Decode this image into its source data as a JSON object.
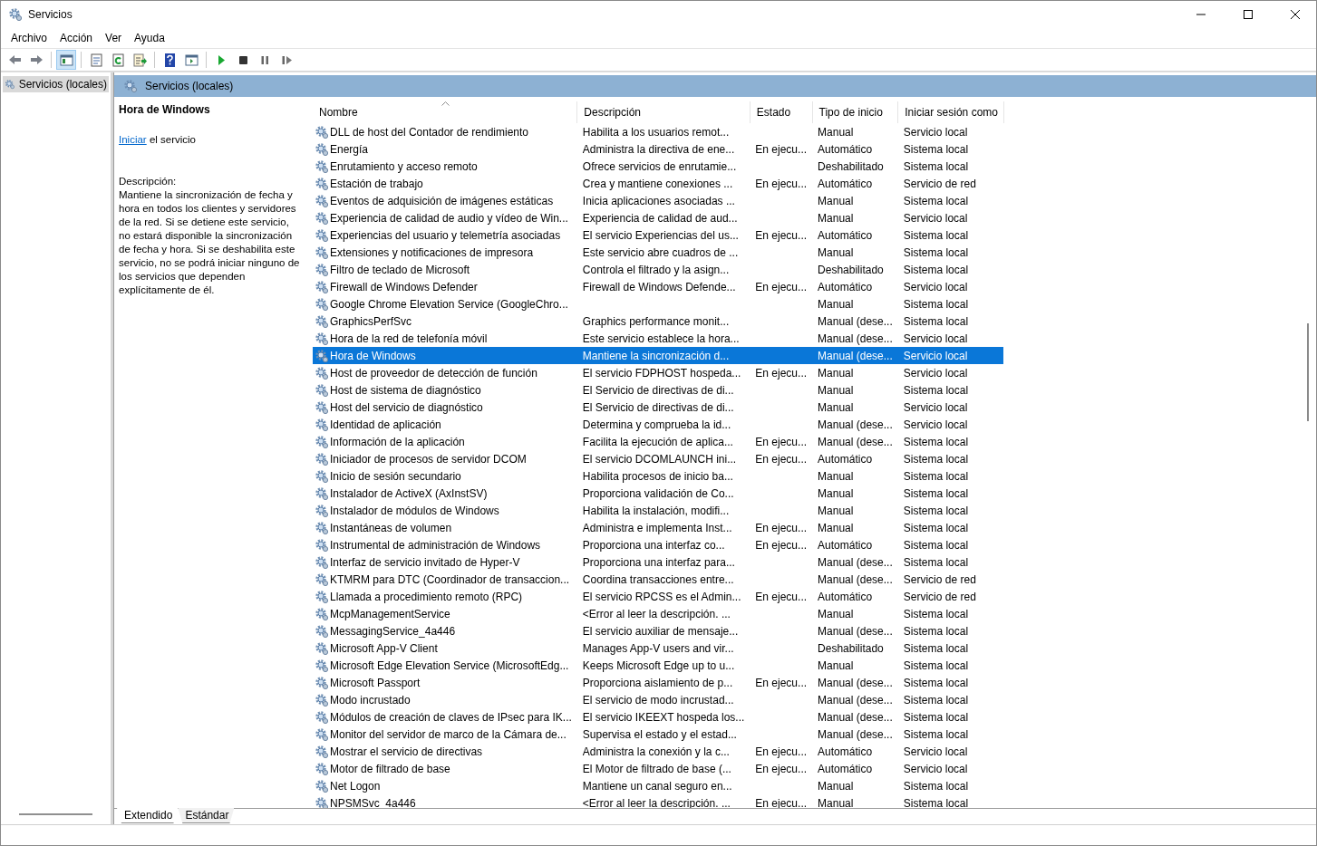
{
  "window": {
    "title": "Servicios"
  },
  "menu": [
    "Archivo",
    "Acción",
    "Ver",
    "Ayuda"
  ],
  "toolbar": [
    {
      "kind": "back",
      "selected": false
    },
    {
      "kind": "forward",
      "selected": false
    },
    {
      "kind": "tree",
      "selected": true
    },
    {
      "kind": "properties",
      "selected": false
    },
    {
      "kind": "refresh",
      "selected": false
    },
    {
      "kind": "export",
      "selected": false
    },
    {
      "kind": "help",
      "selected": false
    },
    {
      "kind": "pane",
      "selected": false
    },
    {
      "kind": "start",
      "selected": false
    },
    {
      "kind": "stop",
      "selected": false
    },
    {
      "kind": "pause",
      "selected": false
    },
    {
      "kind": "resume",
      "selected": false
    }
  ],
  "tree": [
    {
      "label": "Servicios (locales)",
      "selected": true
    }
  ],
  "header": {
    "title": "Servicios (locales)"
  },
  "details": {
    "title": "Hora de Windows",
    "action_link": "Iniciar",
    "action_text": "el servicio",
    "description_label": "Descripción:",
    "description": "Mantiene la sincronización de fecha y hora en todos los clientes y servidores de la red. Si se detiene este servicio, no estará disponible la sincronización de fecha y hora. Si se deshabilita este servicio, no se podrá iniciar ninguno de los servicios que dependen explícitamente de él."
  },
  "table": {
    "columns": [
      {
        "label": "Nombre",
        "sorted": true
      },
      {
        "label": "Descripción",
        "sorted": false
      },
      {
        "label": "Estado",
        "sorted": false
      },
      {
        "label": "Tipo de inicio",
        "sorted": false
      },
      {
        "label": "Iniciar sesión como",
        "sorted": false
      }
    ],
    "rows": [
      {
        "name": "DLL de host del Contador de rendimiento",
        "description": "Habilita a los usuarios remot...",
        "startup": "Manual",
        "logon": "Servicio local",
        "selected": false
      },
      {
        "name": "Energía",
        "description": "Administra la directiva de ene...",
        "status": "En ejecu...",
        "startup": "Automático",
        "logon": "Sistema local",
        "selected": false
      },
      {
        "name": "Enrutamiento y acceso remoto",
        "description": "Ofrece servicios de enrutamie...",
        "startup": "Deshabilitado",
        "logon": "Sistema local",
        "selected": false
      },
      {
        "name": "Estación de trabajo",
        "description": "Crea y mantiene conexiones ...",
        "status": "En ejecu...",
        "startup": "Automático",
        "logon": "Servicio de red",
        "selected": false
      },
      {
        "name": "Eventos de adquisición de imágenes estáticas",
        "description": "Inicia aplicaciones asociadas ...",
        "startup": "Manual",
        "logon": "Sistema local",
        "selected": false
      },
      {
        "name": "Experiencia de calidad de audio y vídeo de Win...",
        "description": "Experiencia de calidad de aud...",
        "startup": "Manual",
        "logon": "Servicio local",
        "selected": false
      },
      {
        "name": "Experiencias del usuario y telemetría asociadas",
        "description": "El servicio Experiencias del us...",
        "status": "En ejecu...",
        "startup": "Automático",
        "logon": "Sistema local",
        "selected": false
      },
      {
        "name": "Extensiones y notificaciones de impresora",
        "description": "Este servicio abre cuadros de ...",
        "startup": "Manual",
        "logon": "Sistema local",
        "selected": false
      },
      {
        "name": "Filtro de teclado de Microsoft",
        "description": "Controla el filtrado y la asign...",
        "startup": "Deshabilitado",
        "logon": "Sistema local",
        "selected": false
      },
      {
        "name": "Firewall de Windows Defender",
        "description": "Firewall de Windows Defende...",
        "status": "En ejecu...",
        "startup": "Automático",
        "logon": "Servicio local",
        "selected": false
      },
      {
        "name": "Google Chrome Elevation Service (GoogleChro...",
        "startup": "Manual",
        "logon": "Sistema local",
        "selected": false
      },
      {
        "name": "GraphicsPerfSvc",
        "description": "Graphics performance monit...",
        "startup": "Manual (dese...",
        "logon": "Sistema local",
        "selected": false
      },
      {
        "name": "Hora de la red de telefonía móvil",
        "description": "Este servicio establece la hora...",
        "startup": "Manual (dese...",
        "logon": "Servicio local",
        "selected": false
      },
      {
        "name": "Hora de Windows",
        "description": "Mantiene la sincronización d...",
        "startup": "Manual (dese...",
        "logon": "Servicio local",
        "selected": true
      },
      {
        "name": "Host de proveedor de detección de función",
        "description": "El servicio FDPHOST hospeda...",
        "status": "En ejecu...",
        "startup": "Manual",
        "logon": "Servicio local",
        "selected": false
      },
      {
        "name": "Host de sistema de diagnóstico",
        "description": "El Servicio de directivas de di...",
        "startup": "Manual",
        "logon": "Sistema local",
        "selected": false
      },
      {
        "name": "Host del servicio de diagnóstico",
        "description": "El Servicio de directivas de di...",
        "startup": "Manual",
        "logon": "Servicio local",
        "selected": false
      },
      {
        "name": "Identidad de aplicación",
        "description": "Determina y comprueba la id...",
        "startup": "Manual (dese...",
        "logon": "Servicio local",
        "selected": false
      },
      {
        "name": "Información de la aplicación",
        "description": "Facilita la ejecución de aplica...",
        "status": "En ejecu...",
        "startup": "Manual (dese...",
        "logon": "Sistema local",
        "selected": false
      },
      {
        "name": "Iniciador de procesos de servidor DCOM",
        "description": "El servicio DCOMLAUNCH ini...",
        "status": "En ejecu...",
        "startup": "Automático",
        "logon": "Sistema local",
        "selected": false
      },
      {
        "name": "Inicio de sesión secundario",
        "description": "Habilita procesos de inicio ba...",
        "startup": "Manual",
        "logon": "Sistema local",
        "selected": false
      },
      {
        "name": "Instalador de ActiveX (AxInstSV)",
        "description": "Proporciona validación de Co...",
        "startup": "Manual",
        "logon": "Sistema local",
        "selected": false
      },
      {
        "name": "Instalador de módulos de Windows",
        "description": "Habilita la instalación, modifi...",
        "startup": "Manual",
        "logon": "Sistema local",
        "selected": false
      },
      {
        "name": "Instantáneas de volumen",
        "description": "Administra e implementa Inst...",
        "status": "En ejecu...",
        "startup": "Manual",
        "logon": "Sistema local",
        "selected": false
      },
      {
        "name": "Instrumental de administración de Windows",
        "description": "Proporciona una interfaz co...",
        "status": "En ejecu...",
        "startup": "Automático",
        "logon": "Sistema local",
        "selected": false
      },
      {
        "name": "Interfaz de servicio invitado de Hyper-V",
        "description": "Proporciona una interfaz para...",
        "startup": "Manual (dese...",
        "logon": "Sistema local",
        "selected": false
      },
      {
        "name": "KTMRM para DTC (Coordinador de transaccion...",
        "description": "Coordina transacciones entre...",
        "startup": "Manual (dese...",
        "logon": "Servicio de red",
        "selected": false
      },
      {
        "name": "Llamada a procedimiento remoto (RPC)",
        "description": "El servicio RPCSS es el Admin...",
        "status": "En ejecu...",
        "startup": "Automático",
        "logon": "Servicio de red",
        "selected": false
      },
      {
        "name": "McpManagementService",
        "description": "<Error al leer la descripción. ...",
        "startup": "Manual",
        "logon": "Sistema local",
        "selected": false
      },
      {
        "name": "MessagingService_4a446",
        "description": "El servicio auxiliar de mensaje...",
        "startup": "Manual (dese...",
        "logon": "Sistema local",
        "selected": false
      },
      {
        "name": "Microsoft App-V Client",
        "description": "Manages App-V users and vir...",
        "startup": "Deshabilitado",
        "logon": "Sistema local",
        "selected": false
      },
      {
        "name": "Microsoft Edge Elevation Service (MicrosoftEdg...",
        "description": "Keeps Microsoft Edge up to u...",
        "startup": "Manual",
        "logon": "Sistema local",
        "selected": false
      },
      {
        "name": "Microsoft Passport",
        "description": "Proporciona aislamiento de p...",
        "status": "En ejecu...",
        "startup": "Manual (dese...",
        "logon": "Sistema local",
        "selected": false
      },
      {
        "name": "Modo incrustado",
        "description": "El servicio de modo incrustad...",
        "startup": "Manual (dese...",
        "logon": "Sistema local",
        "selected": false
      },
      {
        "name": "Módulos de creación de claves de IPsec para IK...",
        "description": "El servicio IKEEXT hospeda los...",
        "startup": "Manual (dese...",
        "logon": "Sistema local",
        "selected": false
      },
      {
        "name": "Monitor del servidor de marco de la Cámara de...",
        "description": "Supervisa el estado y el estad...",
        "startup": "Manual (dese...",
        "logon": "Sistema local",
        "selected": false
      },
      {
        "name": "Mostrar el servicio de directivas",
        "description": "Administra la conexión y la c...",
        "status": "En ejecu...",
        "startup": "Automático",
        "logon": "Servicio local",
        "selected": false
      },
      {
        "name": "Motor de filtrado de base",
        "description": "El Motor de filtrado de base (...",
        "status": "En ejecu...",
        "startup": "Automático",
        "logon": "Servicio local",
        "selected": false
      },
      {
        "name": "Net Logon",
        "description": "Mantiene un canal seguro en...",
        "startup": "Manual",
        "logon": "Sistema local",
        "selected": false
      },
      {
        "name": "NPSMSvc_4a446",
        "description": "<Error al leer la descripción. ...",
        "status": "En ejecu...",
        "startup": "Manual",
        "logon": "Sistema local",
        "selected": false
      }
    ]
  },
  "tabs": [
    {
      "label": "Extendido",
      "selected": true
    },
    {
      "label": "Estándar",
      "selected": false
    }
  ]
}
